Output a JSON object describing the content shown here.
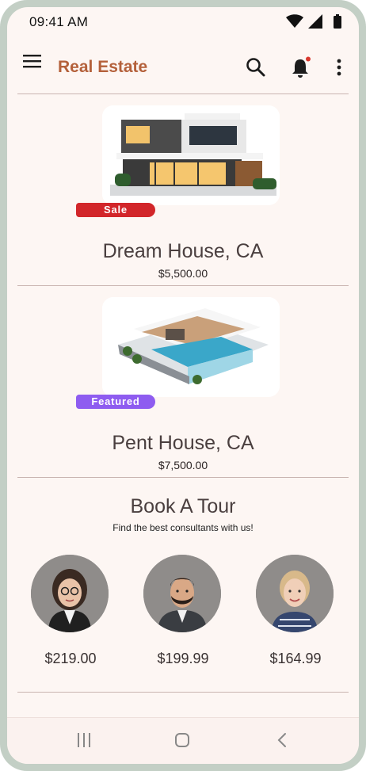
{
  "status_bar": {
    "time": "09:41 AM"
  },
  "app_bar": {
    "title": "Real Estate",
    "icons": [
      "menu-icon",
      "search-icon",
      "bell-icon",
      "more-vert-icon"
    ],
    "accent_color": "#b4603a",
    "notification_dot_color": "#d9382e"
  },
  "listings": [
    {
      "name": "Dream House, CA",
      "price": "$5,500.00",
      "badge": "Sale",
      "badge_color": "#d2262a"
    },
    {
      "name": "Pent House, CA",
      "price": "$7,500.00",
      "badge": "Featured",
      "badge_color": "#8e5cf0"
    }
  ],
  "tour": {
    "title": "Book A Tour",
    "subtitle": "Find the best consultants with us!",
    "consultants": [
      {
        "fee": "$219.00"
      },
      {
        "fee": "$199.99"
      },
      {
        "fee": "$164.99"
      }
    ]
  },
  "nav_bar": {
    "icons": [
      "recent-apps-icon",
      "home-icon",
      "back-icon"
    ]
  }
}
